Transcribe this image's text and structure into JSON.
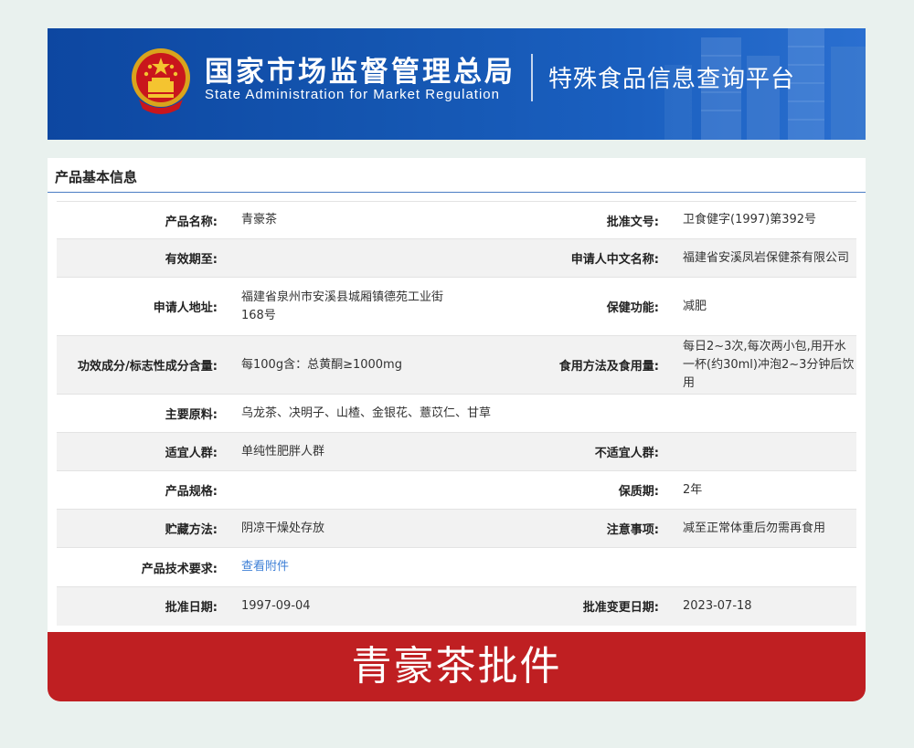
{
  "header": {
    "title_cn": "国家市场监督管理总局",
    "title_en": "State Administration  for  Market Regulation",
    "subtitle": "特殊食品信息查询平台"
  },
  "panel": {
    "title": "产品基本信息"
  },
  "rows": {
    "product_name": {
      "label": "产品名称:",
      "value": "青豪茶"
    },
    "approval_no": {
      "label": "批准文号:",
      "value": "卫食健字(1997)第392号"
    },
    "valid_until": {
      "label": "有效期至:",
      "value": ""
    },
    "applicant_cn": {
      "label": "申请人中文名称:",
      "value": "福建省安溪凤岩保健茶有限公司"
    },
    "applicant_addr": {
      "label": "申请人地址:",
      "value": "福建省泉州市安溪县城厢镇德苑工业街168号"
    },
    "health_function": {
      "label": "保健功能:",
      "value": "减肥"
    },
    "ingredients_content": {
      "label": "功效成分/标志性成分含量:",
      "value": "每100g含：总黄酮≥1000mg"
    },
    "usage": {
      "label": "食用方法及食用量:",
      "value": "每日2~3次,每次两小包,用开水一杯(约30ml)冲泡2~3分钟后饮用"
    },
    "main_materials": {
      "label": "主要原料:",
      "value": "乌龙茶、决明子、山楂、金银花、薏苡仁、甘草"
    },
    "suitable": {
      "label": "适宜人群:",
      "value": "单纯性肥胖人群"
    },
    "unsuitable": {
      "label": "不适宜人群:",
      "value": ""
    },
    "spec": {
      "label": "产品规格:",
      "value": ""
    },
    "shelf_life": {
      "label": "保质期:",
      "value": "2年"
    },
    "storage": {
      "label": "贮藏方法:",
      "value": "阴凉干燥处存放"
    },
    "notes": {
      "label": "注意事项:",
      "value": "减至正常体重后勿需再食用"
    },
    "tech_req": {
      "label": "产品技术要求:",
      "value": "查看附件"
    },
    "approval_date": {
      "label": "批准日期:",
      "value": "1997-09-04"
    },
    "change_date": {
      "label": "批准变更日期:",
      "value": "2023-07-18"
    }
  },
  "banner": {
    "text": "青豪茶批件"
  },
  "colors": {
    "header_blue": "#1455b0",
    "banner_red": "#bf1f22",
    "link_blue": "#3d7fd6"
  }
}
